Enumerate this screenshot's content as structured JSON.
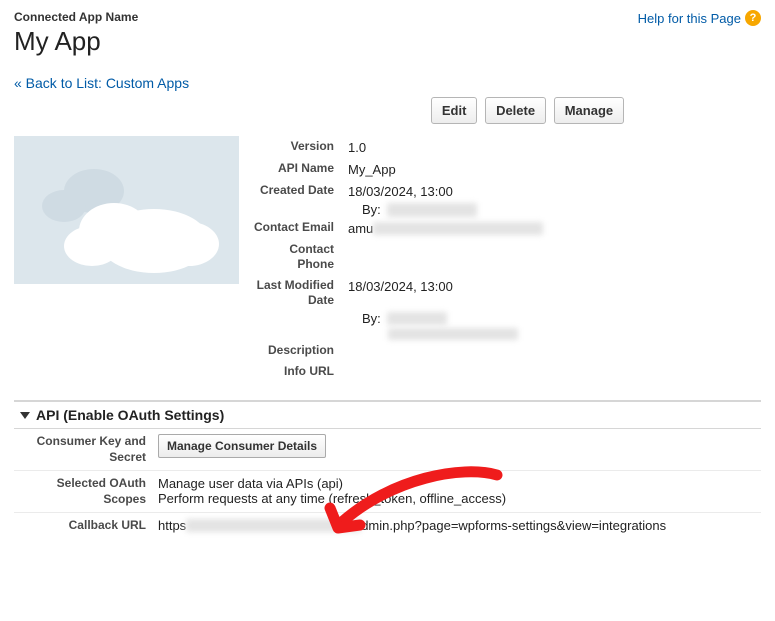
{
  "header": {
    "pretitle": "Connected App Name",
    "title": "My App",
    "help_link": "Help for this Page"
  },
  "back_link": "« Back to List: Custom Apps",
  "buttons": {
    "edit": "Edit",
    "delete": "Delete",
    "manage": "Manage"
  },
  "details": {
    "labels": {
      "version": "Version",
      "api_name": "API Name",
      "created": "Created Date",
      "contact_email": "Contact Email",
      "contact_phone": "Contact Phone",
      "last_modified": "Last Modified Date",
      "description": "Description",
      "info_url": "Info URL"
    },
    "values": {
      "version": "1.0",
      "api_name": "My_App",
      "created": "18/03/2024, 13:00",
      "created_by_prefix": "By:",
      "contact_email_prefix": "amu",
      "last_modified": "18/03/2024, 13:00",
      "last_modified_by_prefix": "By:"
    }
  },
  "api_section": {
    "title": "API (Enable OAuth Settings)",
    "rows": {
      "consumer_label": "Consumer Key and Secret",
      "consumer_btn": "Manage Consumer Details",
      "scopes_label": "Selected OAuth Scopes",
      "scopes_line1": "Manage user data via APIs (api)",
      "scopes_line2": "Perform requests at any time (refresh_token, offline_access)",
      "callback_label": "Callback URL",
      "callback_prefix": "https",
      "callback_suffix": "dmin.php?page=wpforms-settings&view=integrations"
    }
  }
}
